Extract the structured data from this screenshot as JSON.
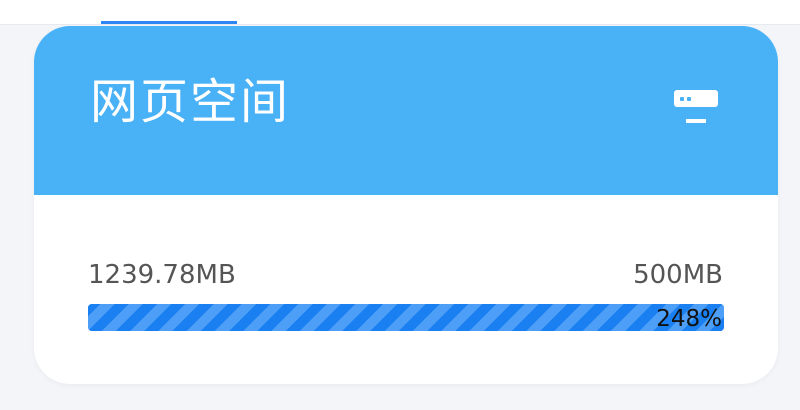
{
  "card": {
    "title": "网页空间",
    "header_color": "#49b1f5",
    "icon": "server-icon"
  },
  "storage": {
    "used": "1239.78MB",
    "total": "500MB",
    "percent_text": "248%",
    "progress_percent": 100,
    "bar_color": "#1a7ff0"
  }
}
